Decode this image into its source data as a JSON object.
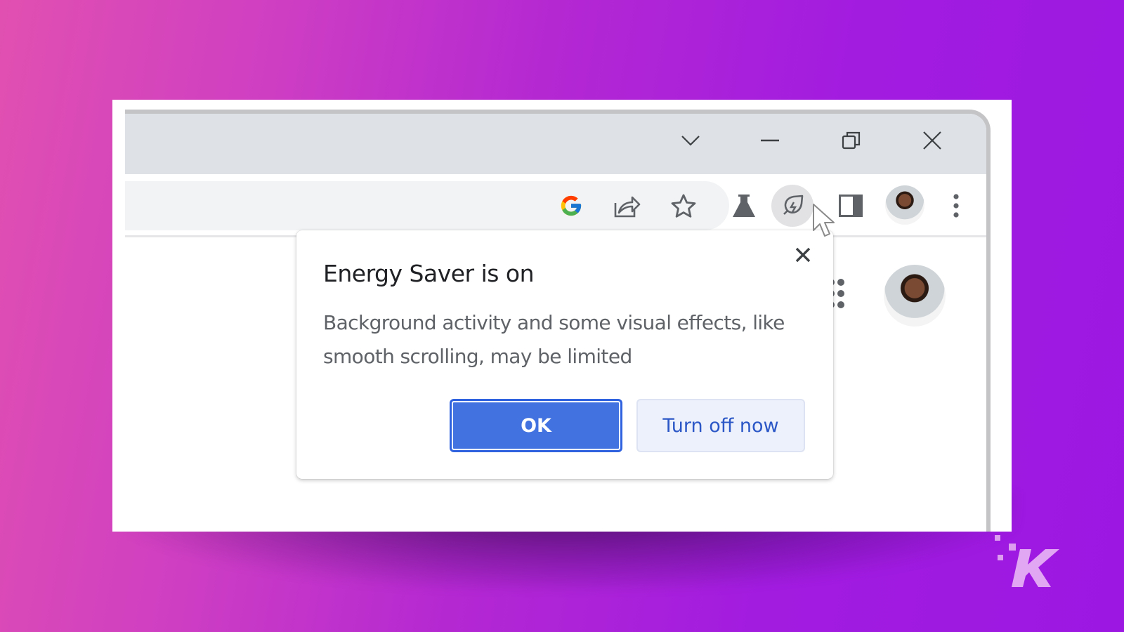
{
  "window_controls": {
    "tab_search": "chevron-down",
    "minimize": "minimize",
    "restore": "restore",
    "close": "close"
  },
  "toolbar": {
    "omnibox_icons": [
      "google-g-icon",
      "share-icon",
      "star-icon"
    ],
    "extension_icons": [
      "labs-flask-icon",
      "energy-saver-leaf-icon",
      "side-panel-icon",
      "profile-avatar",
      "more-menu-icon"
    ]
  },
  "dialog": {
    "title": "Energy Saver is on",
    "body": "Background activity and some visual effects, like smooth scrolling, may be limited",
    "ok_label": "OK",
    "turn_off_label": "Turn off now",
    "close_icon": "close-icon"
  },
  "page": {
    "apps_icon": "apps-grid-icon",
    "account_avatar": "account-avatar"
  },
  "colors": {
    "primary_button": "#4272e0",
    "secondary_button_bg": "#edf1fb",
    "secondary_button_text": "#2b58c6",
    "titlebar": "#dee1e6",
    "background_pink": "#e150b0",
    "background_purple": "#9c18e2"
  },
  "watermark": {
    "logo": "K"
  }
}
